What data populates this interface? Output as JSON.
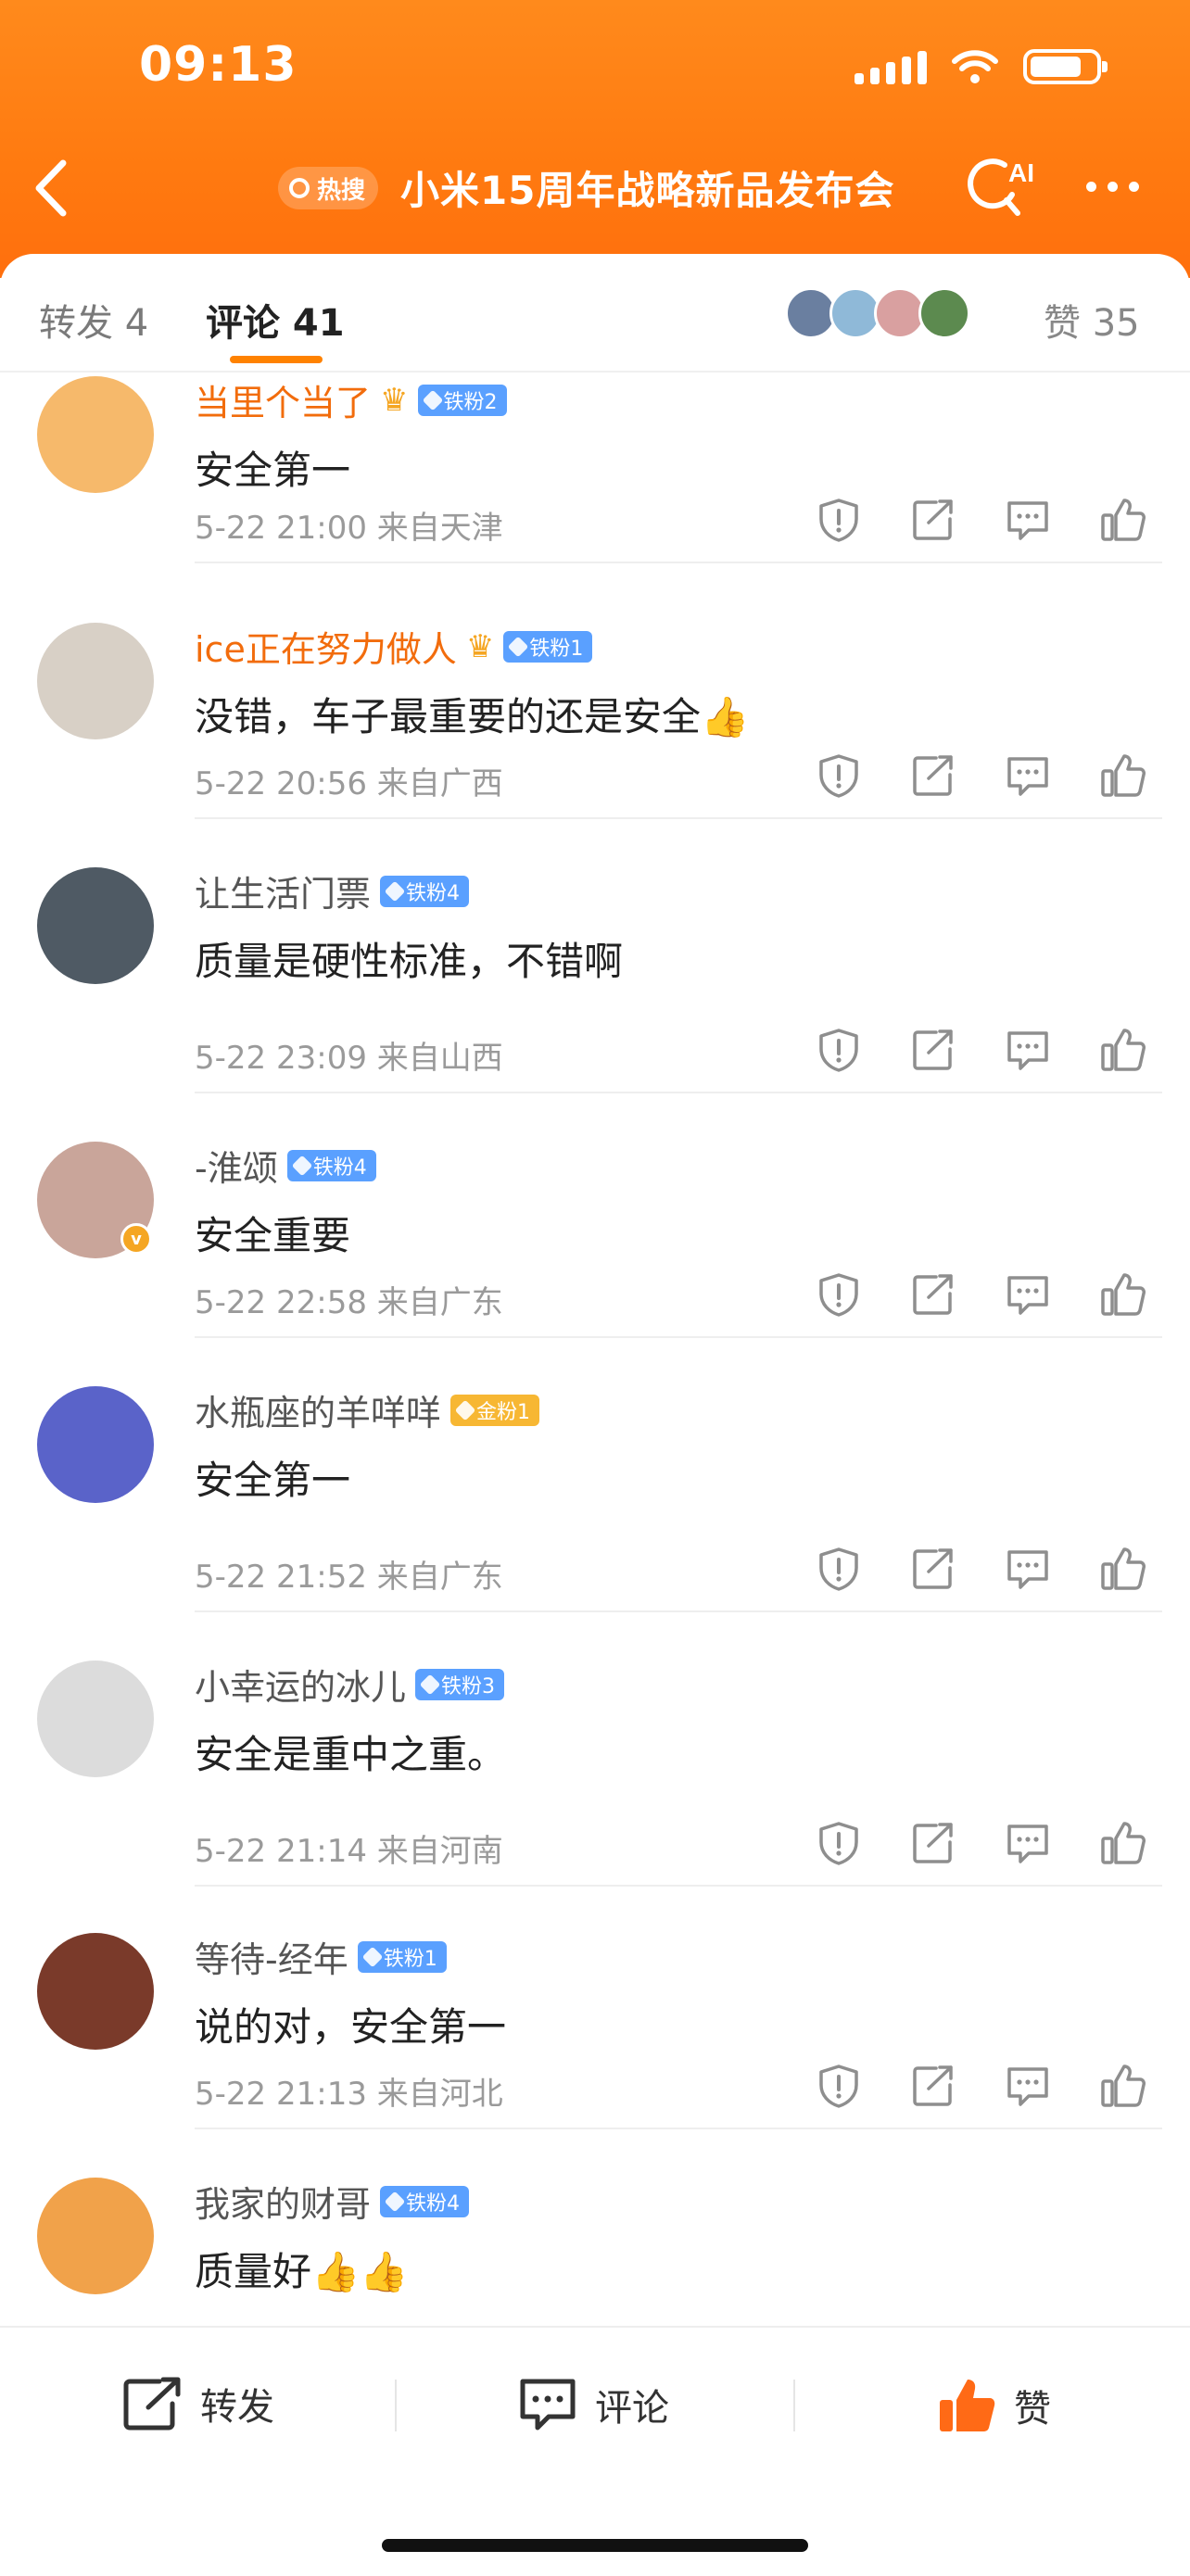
{
  "status_bar": {
    "time": "09:13"
  },
  "header": {
    "hot_tag": "热搜",
    "title": "小米15周年战略新品发布会",
    "ai_label": "AI"
  },
  "tabs": {
    "repost": "转发 4",
    "comments": "评论 41",
    "likes": "赞 35"
  },
  "comments": [
    {
      "name": "当里个当了",
      "badge": "铁粉2",
      "badge_type": "iron",
      "crown": true,
      "name_color": "orange",
      "text": "安全第一",
      "time": "5-22 21:00 来自天津"
    },
    {
      "name": "ice正在努力做人",
      "badge": "铁粉1",
      "badge_type": "iron",
      "crown": true,
      "name_color": "orange",
      "text": "没错，车子最重要的还是安全👍",
      "time": "5-22 20:56 来自广西"
    },
    {
      "name": "让生活门票",
      "badge": "铁粉4",
      "badge_type": "iron",
      "crown": false,
      "name_color": "gray",
      "text": "质量是硬性标准，不错啊",
      "time": "5-22 23:09 来自山西"
    },
    {
      "name": "-淮颂",
      "badge": "铁粉4",
      "badge_type": "iron",
      "crown": false,
      "name_color": "gray",
      "text": "安全重要",
      "time": "5-22 22:58 来自广东",
      "verified": true
    },
    {
      "name": "水瓶座的羊咩咩",
      "badge": "金粉1",
      "badge_type": "gold",
      "crown": false,
      "name_color": "gray",
      "text": "安全第一",
      "time": "5-22 21:52 来自广东"
    },
    {
      "name": "小幸运的冰儿",
      "badge": "铁粉3",
      "badge_type": "iron",
      "crown": false,
      "name_color": "gray",
      "text": "安全是重中之重。",
      "time": "5-22 21:14 来自河南"
    },
    {
      "name": "等待-经年",
      "badge": "铁粉1",
      "badge_type": "iron",
      "crown": false,
      "name_color": "gray",
      "text": "说的对，安全第一",
      "time": "5-22 21:13 来自河北"
    },
    {
      "name": "我家的财哥",
      "badge": "铁粉4",
      "badge_type": "iron",
      "crown": false,
      "name_color": "gray",
      "text": "质量好👍👍",
      "time": ""
    }
  ],
  "bottom_bar": {
    "repost": "转发",
    "comment": "评论",
    "like": "赞"
  },
  "colors": {
    "brand_orange": "#ff7a10",
    "name_orange": "#f26c0c",
    "iron_badge": "#5aa0ff",
    "gold_badge": "#f7b733"
  }
}
